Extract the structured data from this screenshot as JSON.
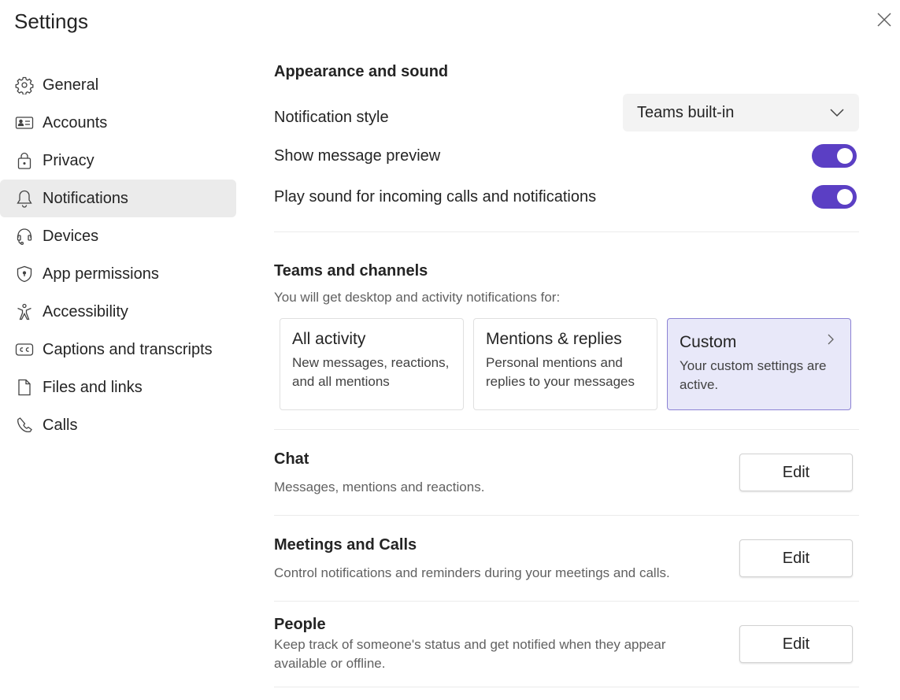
{
  "window": {
    "title": "Settings",
    "close_icon": "close-icon"
  },
  "sidebar": {
    "items": [
      {
        "label": "General",
        "icon": "gear-icon",
        "active": false
      },
      {
        "label": "Accounts",
        "icon": "contact-card-icon",
        "active": false
      },
      {
        "label": "Privacy",
        "icon": "lock-icon",
        "active": false
      },
      {
        "label": "Notifications",
        "icon": "bell-icon",
        "active": true
      },
      {
        "label": "Devices",
        "icon": "headset-icon",
        "active": false
      },
      {
        "label": "App permissions",
        "icon": "shield-icon",
        "active": false
      },
      {
        "label": "Accessibility",
        "icon": "accessibility-icon",
        "active": false
      },
      {
        "label": "Captions and transcripts",
        "icon": "closed-captions-icon",
        "active": false
      },
      {
        "label": "Files and links",
        "icon": "document-icon",
        "active": false
      },
      {
        "label": "Calls",
        "icon": "phone-icon",
        "active": false
      }
    ]
  },
  "appearance": {
    "title": "Appearance and sound",
    "notification_style_label": "Notification style",
    "notification_style_value": "Teams built-in",
    "show_preview_label": "Show message preview",
    "show_preview_on": true,
    "play_sound_label": "Play sound for incoming calls and notifications",
    "play_sound_on": true
  },
  "teams_channels": {
    "title": "Teams and channels",
    "subtitle": "You will get desktop and activity notifications for:",
    "options": [
      {
        "title": "All activity",
        "desc": "New messages, reactions, and all mentions",
        "selected": false
      },
      {
        "title": "Mentions & replies",
        "desc": "Personal mentions and replies to your messages",
        "selected": false
      },
      {
        "title": "Custom",
        "desc": "Your custom settings are active.",
        "selected": true
      }
    ]
  },
  "sections": [
    {
      "title": "Chat",
      "desc": "Messages, mentions and reactions.",
      "button": "Edit"
    },
    {
      "title": "Meetings and Calls",
      "desc": "Control notifications and reminders during your meetings and calls.",
      "button": "Edit"
    },
    {
      "title": "People",
      "desc": "Keep track of someone's status and get notified when they appear available or offline.",
      "button": "Edit"
    }
  ],
  "colors": {
    "accent": "#5b3fc4",
    "selected_card_bg": "#e8e8f9",
    "active_nav_bg": "#ebebeb"
  }
}
